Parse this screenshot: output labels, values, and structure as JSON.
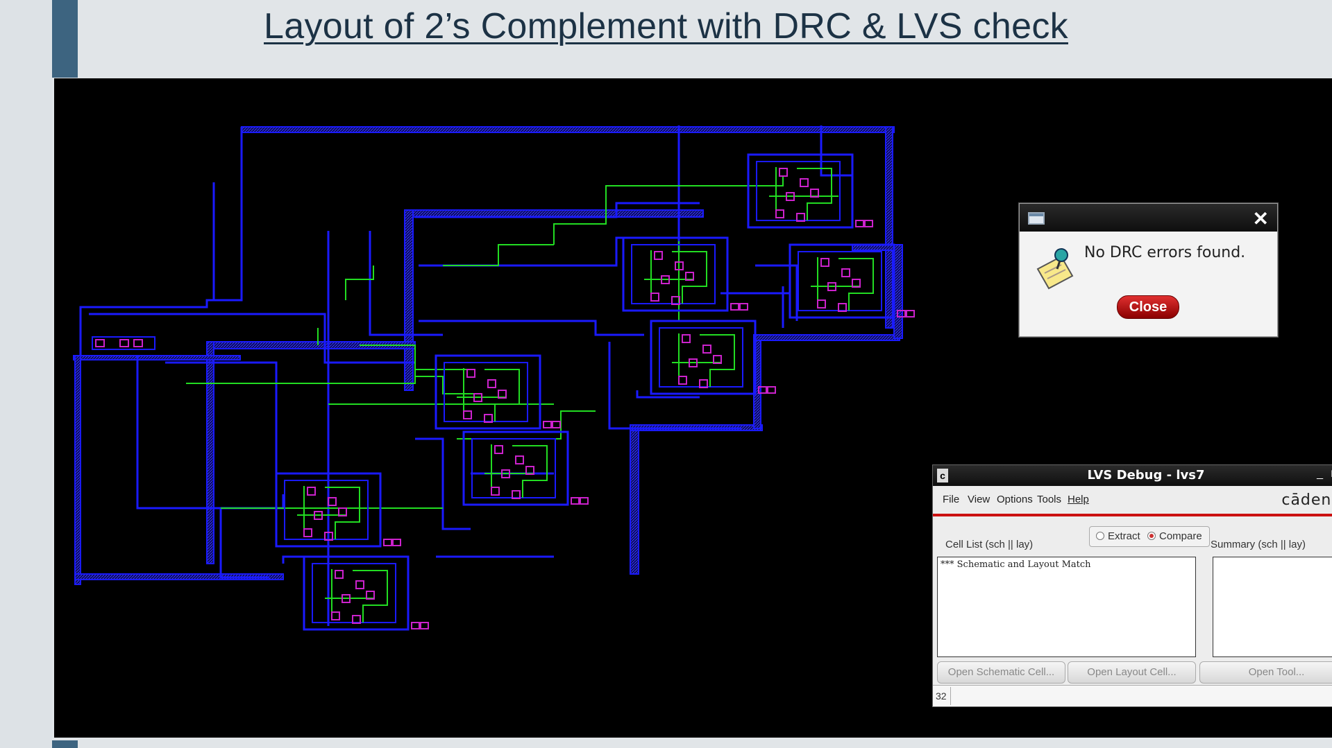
{
  "slide": {
    "title": "Layout of 2’s Complement with DRC & LVS check"
  },
  "drc_dialog": {
    "message": "No DRC errors found.",
    "close_label": "Close",
    "close_icon": "close-x-icon",
    "window_icon": "window-icon",
    "note_icon": "notepad-pin-icon"
  },
  "lvs_window": {
    "title": "LVS Debug - lvs7",
    "app_icon_glyph": "c",
    "window_controls": [
      "_",
      "□",
      "×"
    ],
    "menu": [
      "File",
      "View",
      "Options",
      "Tools",
      "Help"
    ],
    "brand": "cādence",
    "modes": {
      "extract": "Extract",
      "compare": "Compare",
      "selected": "Compare"
    },
    "cell_list_label": "Cell List (sch || lay)",
    "summary_label": "Summary (sch || lay)",
    "cell_list_text": "*** Schematic and Layout Match",
    "buttons": [
      "Open Schematic Cell...",
      "Open Layout Cell...",
      "Open Tool..."
    ],
    "status_number": "32"
  },
  "colors": {
    "metal1": "#1a1aff",
    "poly": "#22dd22",
    "contact": "#cc22cc",
    "canvas": "#000000",
    "accent": "#3d6480"
  }
}
